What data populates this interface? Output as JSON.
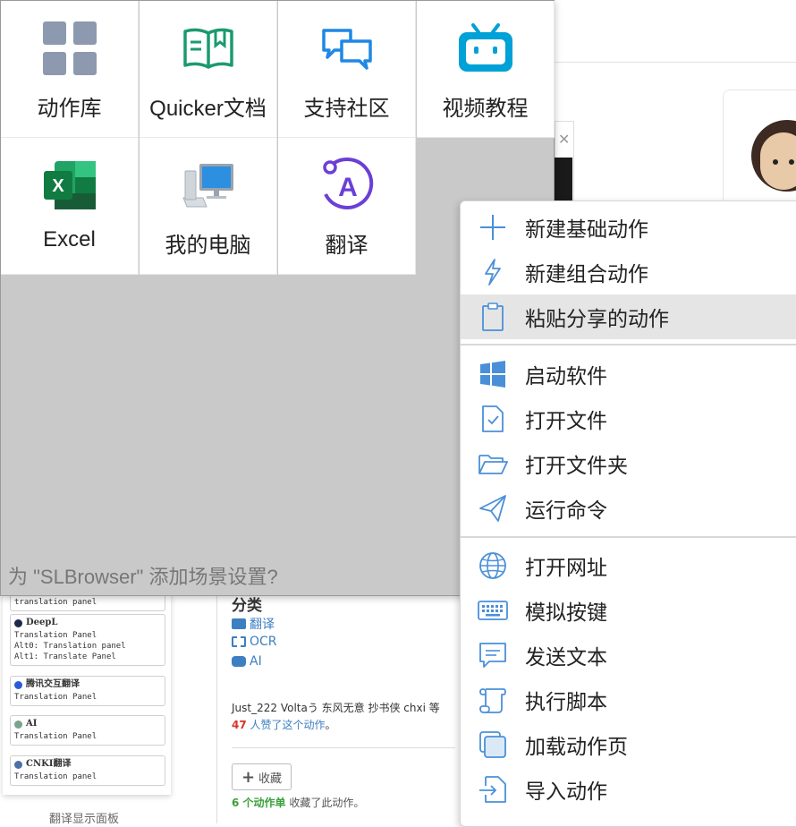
{
  "colors": {
    "menu_icon": "#4a90d9",
    "panel_bg": "#c9c9c9",
    "link": "#3d7fc1",
    "highlight": "#e5e5e5"
  },
  "panel": {
    "tiles": [
      {
        "label": "动作库",
        "icon": "grid-icon"
      },
      {
        "label": "Quicker文档",
        "icon": "book-icon"
      },
      {
        "label": "支持社区",
        "icon": "chat-icon"
      },
      {
        "label": "视频教程",
        "icon": "bilibili-icon"
      },
      {
        "label": "Excel",
        "icon": "excel-icon"
      },
      {
        "label": "我的电脑",
        "icon": "computer-icon"
      },
      {
        "label": "翻译",
        "icon": "translate-icon"
      }
    ],
    "hint": "为 \"SLBrowser\" 添加场景设置?"
  },
  "menu": {
    "items": [
      {
        "label": "新建基础动作",
        "icon": "plus-icon"
      },
      {
        "label": "新建组合动作",
        "icon": "lightning-icon"
      },
      {
        "label": "粘贴分享的动作",
        "icon": "clipboard-icon"
      },
      {
        "label": "启动软件",
        "icon": "windows-icon"
      },
      {
        "label": "打开文件",
        "icon": "file-check-icon"
      },
      {
        "label": "打开文件夹",
        "icon": "folder-icon"
      },
      {
        "label": "运行命令",
        "icon": "paper-plane-icon"
      },
      {
        "label": "打开网址",
        "icon": "globe-icon"
      },
      {
        "label": "模拟按键",
        "icon": "keyboard-icon"
      },
      {
        "label": "发送文本",
        "icon": "message-icon"
      },
      {
        "label": "执行脚本",
        "icon": "scroll-icon"
      },
      {
        "label": "加载动作页",
        "icon": "pages-icon"
      },
      {
        "label": "导入动作",
        "icon": "import-icon"
      }
    ],
    "highlighted": "粘贴分享的动作"
  },
  "background": {
    "sidebar": {
      "items": [
        {
          "title": "",
          "lines": [
            "translation panel"
          ]
        },
        {
          "title": "DeepL",
          "lines": [
            "Translation Panel",
            "Alt0: Translation panel",
            "Alt1: Translate Panel"
          ]
        },
        {
          "title": "腾讯交互翻译",
          "lines": [
            "Translation Panel"
          ]
        },
        {
          "title": "AI",
          "lines": [
            "Translation Panel"
          ]
        },
        {
          "title": "CNKI翻译",
          "lines": [
            "Translation panel"
          ]
        }
      ],
      "caption": "翻译显示面板"
    },
    "category": {
      "title": "分类",
      "links": [
        "翻译",
        "OCR",
        "AI"
      ]
    },
    "likes": {
      "users": "Just_222 Voltaう 东风无意 抄书侠 chxi",
      "prefix": "等",
      "count": "47",
      "suffix": "人赞了这个动作",
      "end": "。"
    },
    "favorite_button": "收藏",
    "lists": {
      "count": "6 个动作单",
      "text": "收藏了此动作。"
    }
  }
}
